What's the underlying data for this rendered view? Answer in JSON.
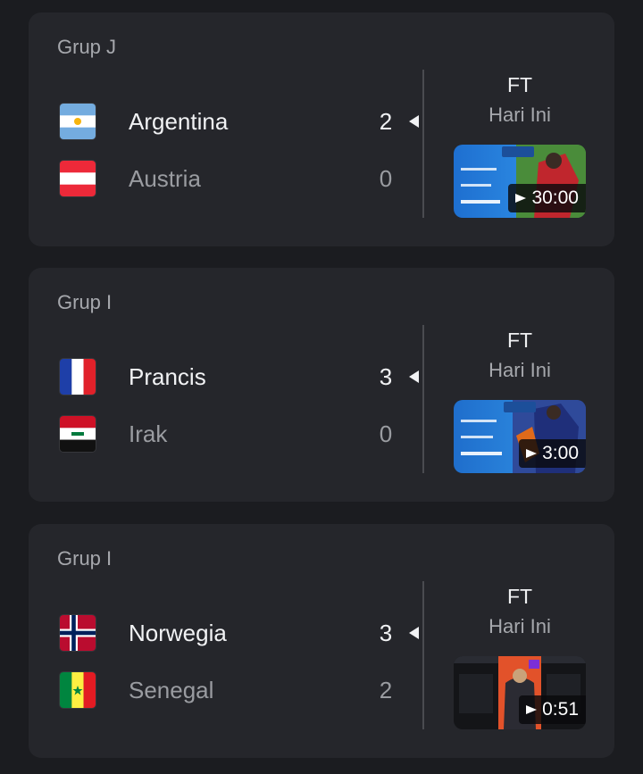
{
  "matches": [
    {
      "group": "Grup J",
      "home": {
        "name": "Argentina",
        "score": "2",
        "flag": "argentina-flag-icon"
      },
      "away": {
        "name": "Austria",
        "score": "0",
        "flag": "austria-flag-icon"
      },
      "status": "FT",
      "date": "Hari Ini",
      "video_duration": "30:00"
    },
    {
      "group": "Grup I",
      "home": {
        "name": "Prancis",
        "score": "3",
        "flag": "france-flag-icon"
      },
      "away": {
        "name": "Irak",
        "score": "0",
        "flag": "iraq-flag-icon"
      },
      "status": "FT",
      "date": "Hari Ini",
      "video_duration": "3:00"
    },
    {
      "group": "Grup I",
      "home": {
        "name": "Norwegia",
        "score": "3",
        "flag": "norway-flag-icon"
      },
      "away": {
        "name": "Senegal",
        "score": "2",
        "flag": "senegal-flag-icon"
      },
      "status": "FT",
      "date": "Hari Ini",
      "video_duration": "0:51"
    }
  ],
  "colors": {
    "background": "#1b1c20",
    "card": "#25262b",
    "text_primary": "#f1f2f4",
    "text_secondary": "#9a9ca1"
  }
}
